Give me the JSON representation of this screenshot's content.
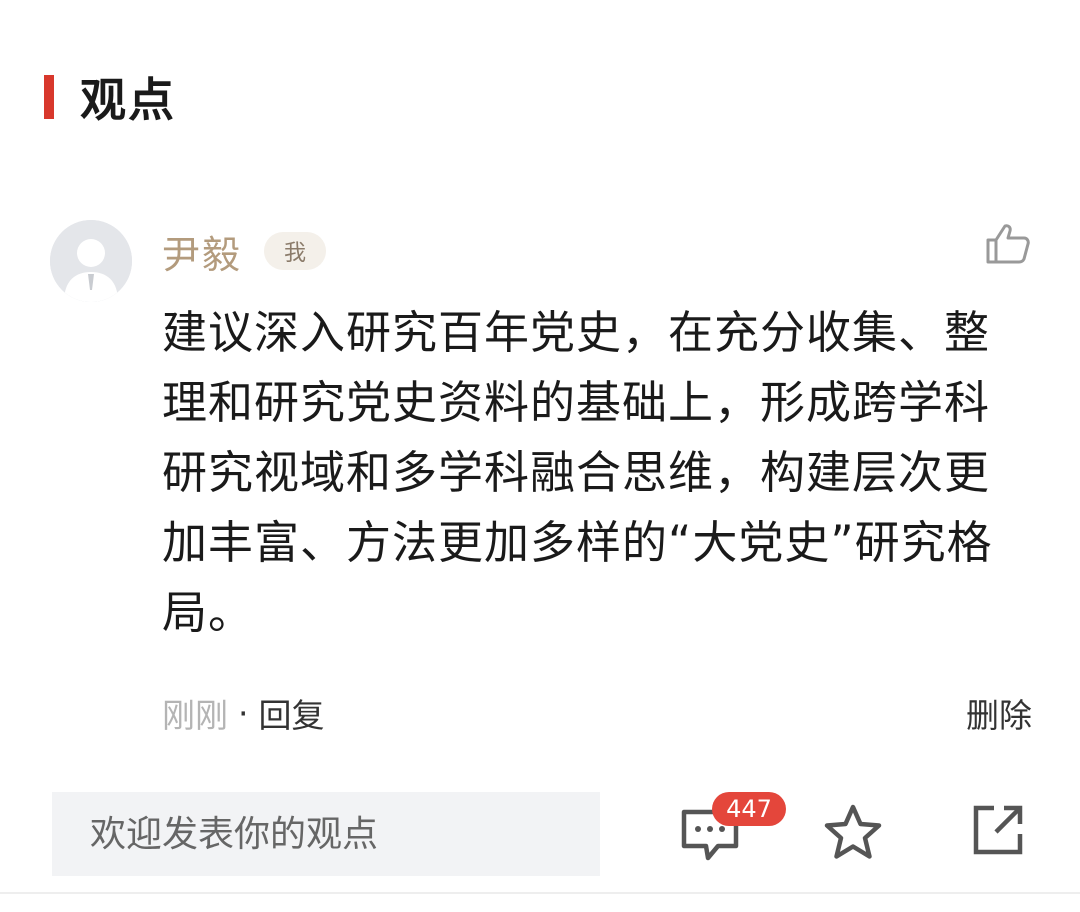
{
  "section": {
    "title": "观点"
  },
  "comment": {
    "author": "尹毅",
    "badge": "我",
    "body": "建议深入研究百年党史，在充分收集、整理和研究党史资料的基础上，形成跨学科研究视域和多学科融合思维，构建层次更加丰富、方法更加多样的“大党史”研究格局。",
    "time": "刚刚",
    "separator": "·",
    "reply_label": "回复",
    "delete_label": "删除",
    "icons": {
      "like": "thumbs-up-icon",
      "avatar": "default-avatar-icon"
    }
  },
  "bottom_bar": {
    "input_placeholder": "欢迎发表你的观点",
    "comment_count": "447",
    "icons": {
      "comments": "comment-bubble-icon",
      "favorite": "star-icon",
      "share": "share-icon"
    }
  },
  "colors": {
    "accent": "#d8382c",
    "author": "#b39b7d",
    "badge": "#e4463b"
  }
}
